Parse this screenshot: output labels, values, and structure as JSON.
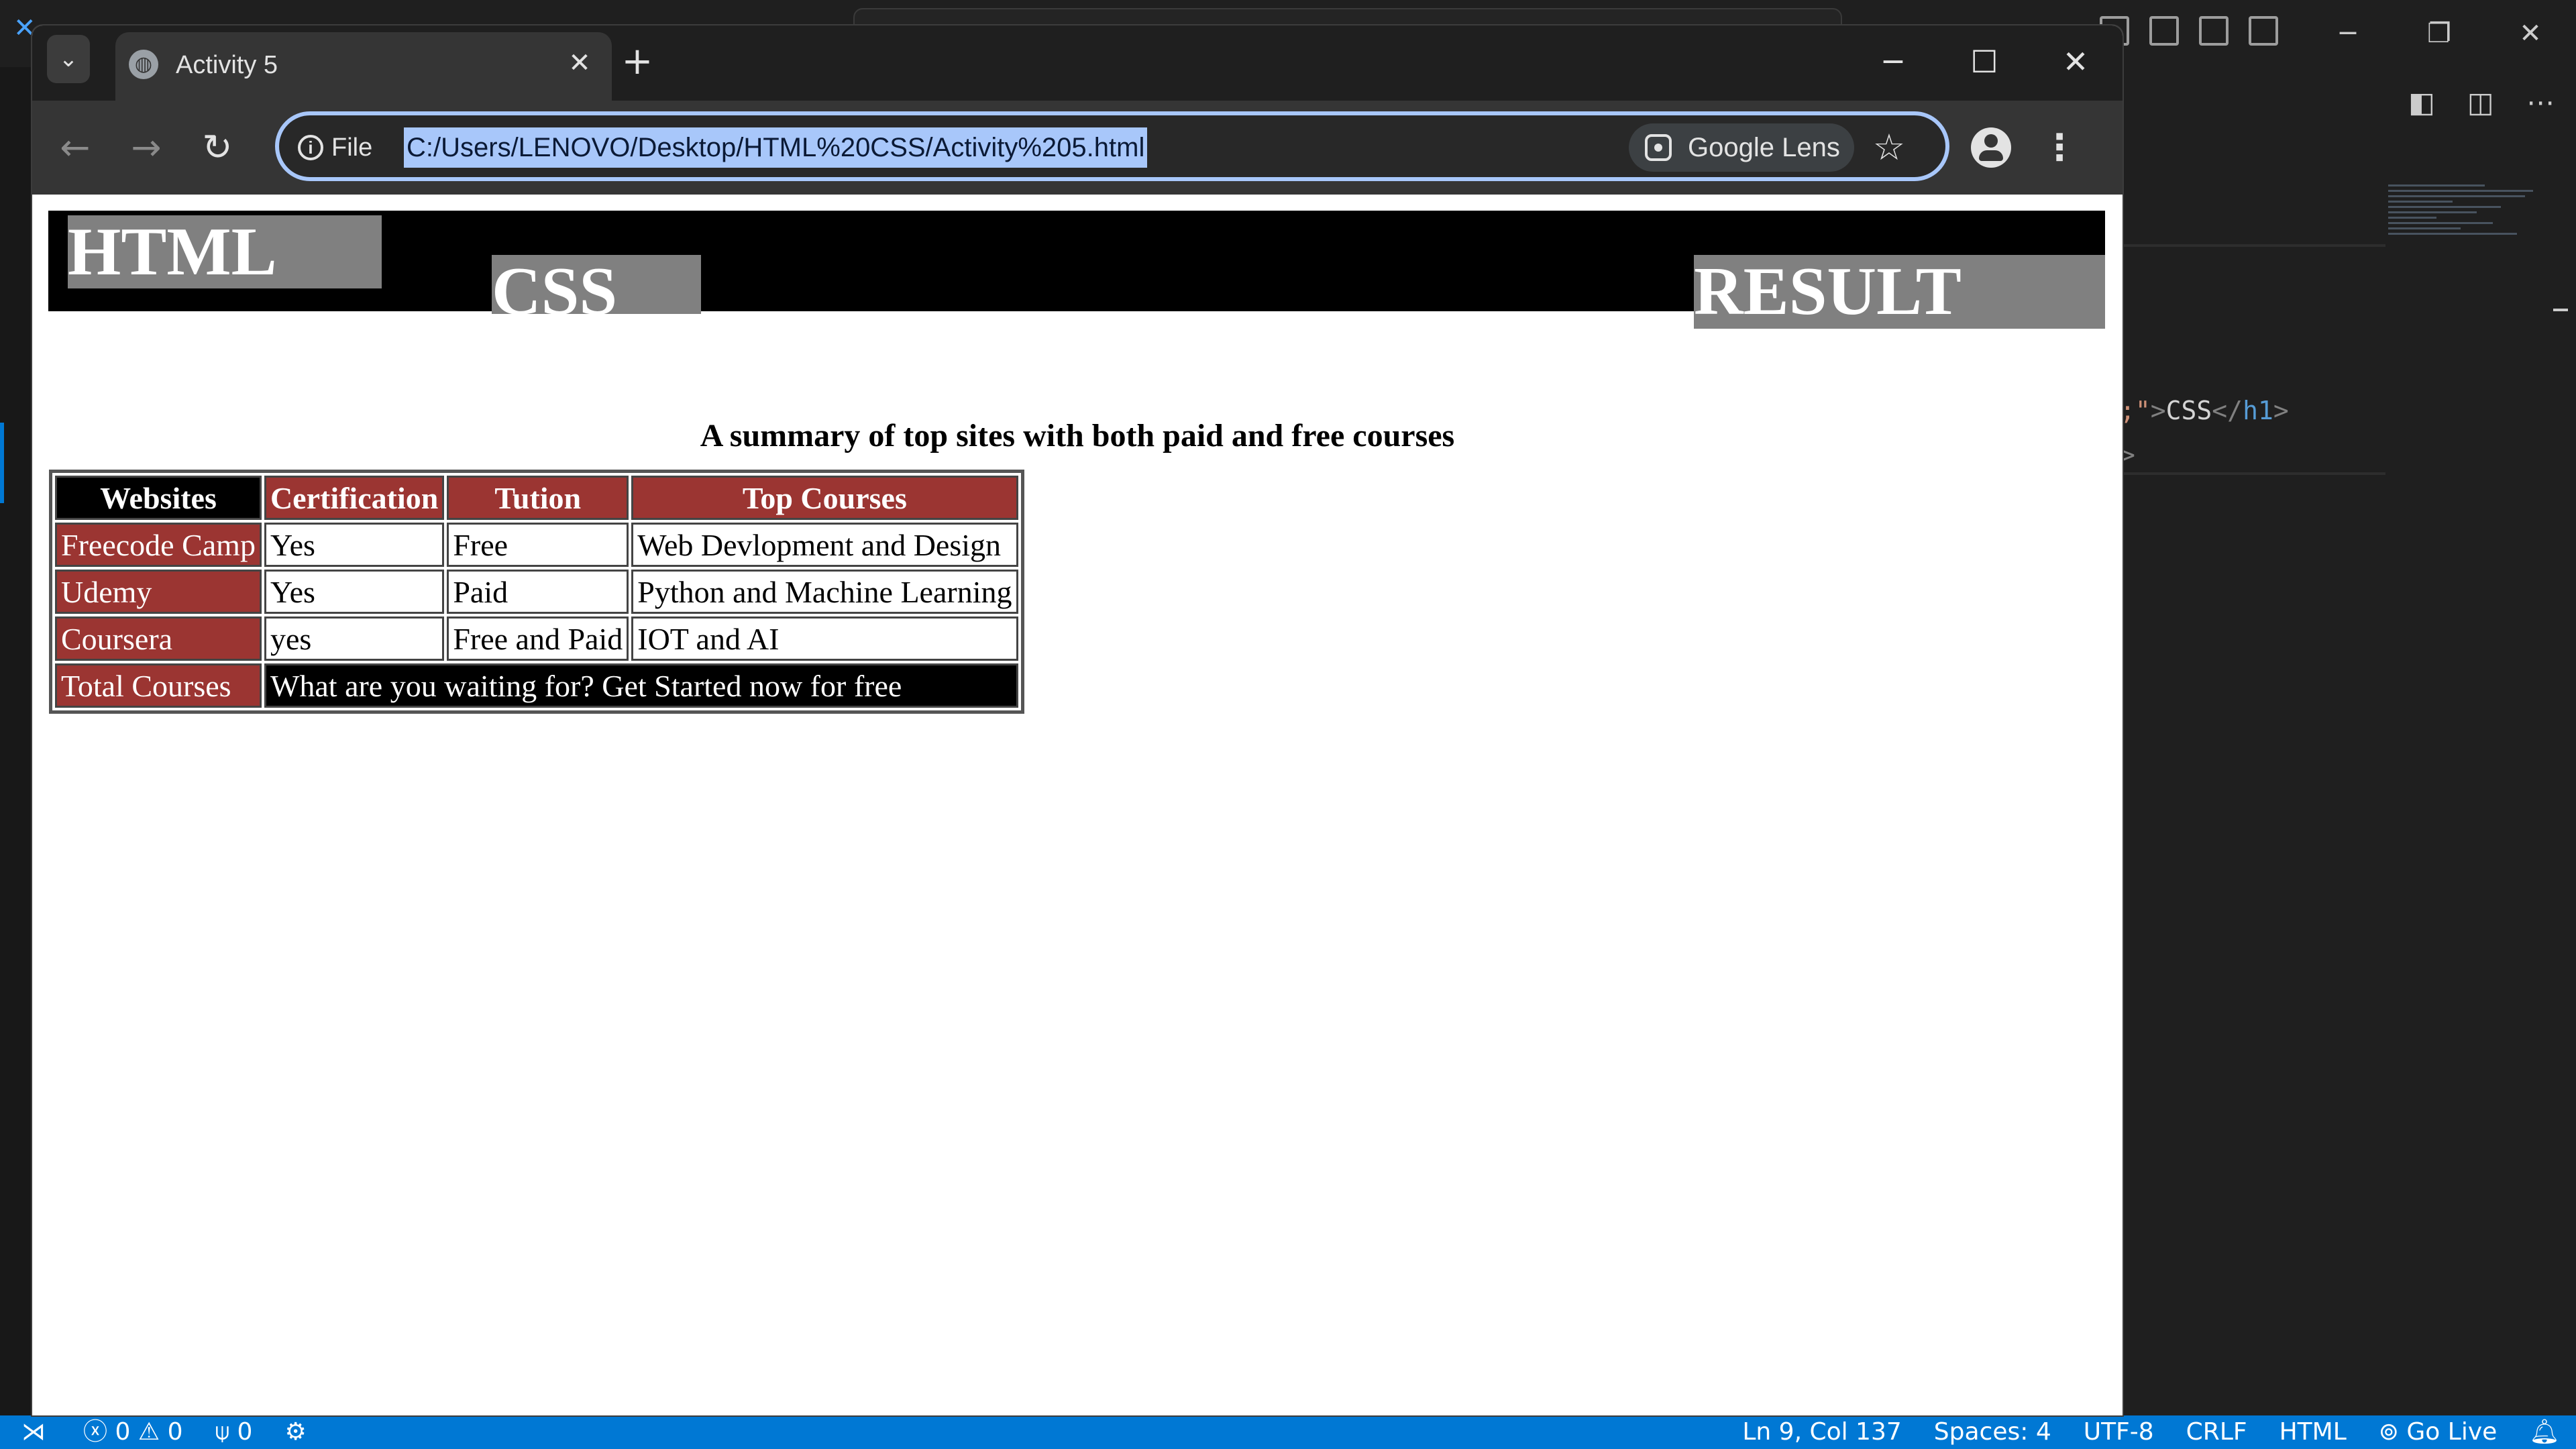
{
  "vscode": {
    "code_line": [
      ";\"",
      ">",
      "CSS",
      "</",
      "h1",
      ">"
    ],
    "code_line2": ">",
    "status": {
      "problems_errors": "0",
      "problems_warnings": "0",
      "ports": "0",
      "position": "Ln 9, Col 137",
      "spaces": "Spaces: 4",
      "encoding": "UTF-8",
      "eol": "CRLF",
      "language": "HTML",
      "go_live": "Go Live"
    }
  },
  "browser": {
    "tab_title": "Activity 5",
    "site_info_label": "File",
    "url": "C:/Users/LENOVO/Desktop/HTML%20CSS/Activity%205.html",
    "lens_label": "Google Lens"
  },
  "page": {
    "heading_html": "HTML",
    "heading_css": "CSS",
    "heading_result": "RESULT",
    "summary": "A summary of top sites with both paid and free courses",
    "table": {
      "headers": [
        "Websites",
        "Certification",
        "Tution",
        "Top Courses"
      ],
      "rows": [
        [
          "Freecode Camp",
          "Yes",
          "Free",
          "Web Devlopment and Design"
        ],
        [
          "Udemy",
          "Yes",
          "Paid",
          "Python and Machine Learning"
        ],
        [
          "Coursera",
          "yes",
          "Free and Paid",
          "IOT and AI"
        ]
      ],
      "footer_label": "Total Courses",
      "footer_text": "What are you waiting for? Get Started now for free"
    }
  },
  "colors": {
    "accent_blue": "#0078d4",
    "table_header_red": "#9b3532",
    "heading_gray": "#808080",
    "url_highlight": "#a8c7fa"
  }
}
